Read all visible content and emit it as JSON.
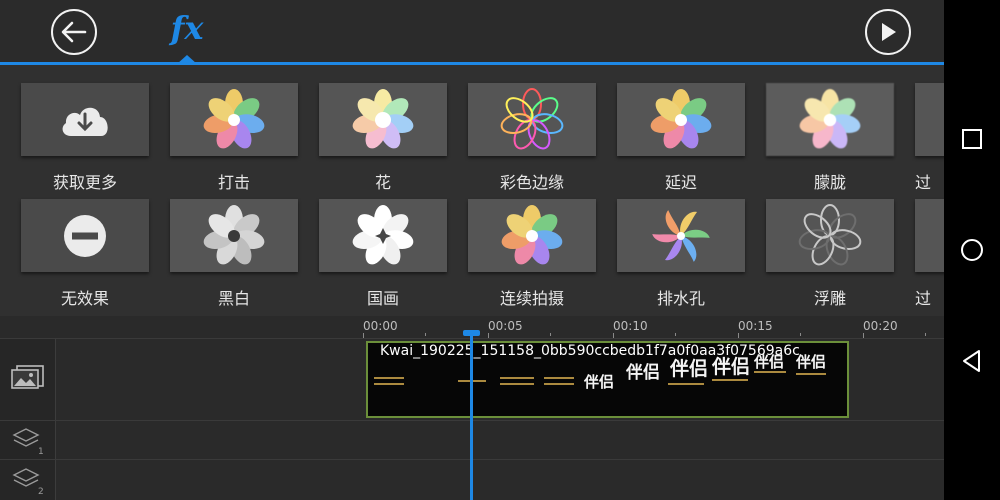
{
  "toolbar": {
    "back_icon": "arrow-left-icon",
    "fx_label": "fx",
    "play_icon": "play-icon"
  },
  "effects": {
    "row1": [
      {
        "label": "获取更多",
        "thumb": "cloud-download-icon"
      },
      {
        "label": "打击"
      },
      {
        "label": "花"
      },
      {
        "label": "彩色边缘"
      },
      {
        "label": "延迟"
      },
      {
        "label": "朦胧"
      },
      {
        "label": "过"
      }
    ],
    "row2": [
      {
        "label": "无效果",
        "thumb": "no-entry-icon"
      },
      {
        "label": "黑白"
      },
      {
        "label": "国画"
      },
      {
        "label": "连续拍摄"
      },
      {
        "label": "排水孔"
      },
      {
        "label": "浮雕"
      },
      {
        "label": "过"
      }
    ]
  },
  "timeline": {
    "ruler": [
      "00:00",
      "00:05",
      "00:10",
      "00:15",
      "00:20"
    ],
    "clip_name": "Kwai_190225_151158_0bb590ccbedb1f7a0f0aa3f07569a6c",
    "clip_texts": [
      "伴侣",
      "伴侣",
      "伴侣",
      "伴侣",
      "伴侣",
      "伴侣"
    ],
    "tracks": [
      {
        "icon": "image-track-icon"
      },
      {
        "icon": "layer-1-icon",
        "number": "1"
      },
      {
        "icon": "layer-2-icon",
        "number": "2"
      }
    ]
  },
  "navbar": {
    "recent_icon": "square-recent-icon",
    "home_icon": "circle-home-icon",
    "back_icon": "triangle-back-icon"
  },
  "colors": {
    "accent": "#1e88e5",
    "background": "#2e2e2e",
    "clip_border": "#6b8f3a"
  }
}
